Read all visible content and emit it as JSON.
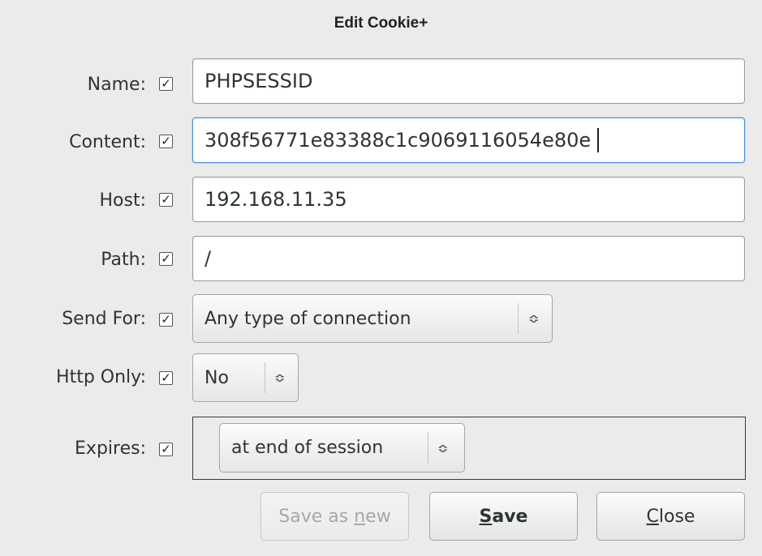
{
  "dialog": {
    "title": "Edit Cookie+"
  },
  "fields": {
    "name": {
      "label": "Name:",
      "value": "PHPSESSID",
      "checked": true
    },
    "content": {
      "label": "Content:",
      "value": "308f56771e83388c1c9069116054e80e",
      "checked": true
    },
    "host": {
      "label": "Host:",
      "value": "192.168.11.35",
      "checked": true
    },
    "path": {
      "label": "Path:",
      "value": "/",
      "checked": true
    },
    "send_for": {
      "label": "Send For:",
      "value": "Any type of connection",
      "checked": true
    },
    "http_only": {
      "label": "Http Only:",
      "value": "No",
      "checked": true
    },
    "expires": {
      "label": "Expires:",
      "value": "at end of session",
      "checked": true
    }
  },
  "icons": {
    "checkbox": "checkbox-checked-icon",
    "combo_arrow": "up-down-arrows-icon"
  },
  "buttons": {
    "save_as_new": {
      "prefix": "Save as ",
      "mnemonic": "n",
      "suffix": "ew",
      "enabled": false
    },
    "save": {
      "mnemonic": "S",
      "suffix": "ave"
    },
    "close": {
      "mnemonic": "C",
      "suffix": "lose"
    }
  },
  "colors": {
    "focus_border": "#4a90d9",
    "background": "#ebebeb"
  }
}
